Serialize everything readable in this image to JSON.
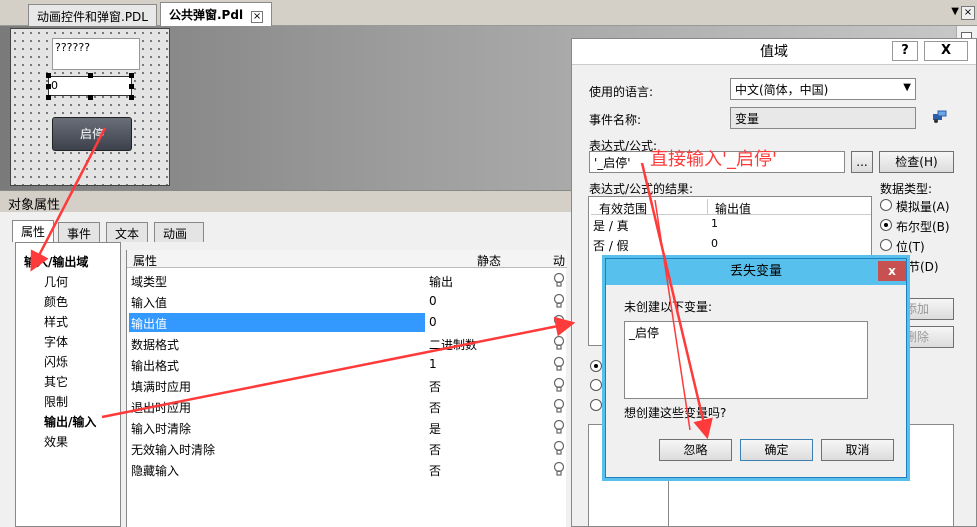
{
  "tabs": [
    {
      "label": "动画控件和弹窗.PDL",
      "active": false
    },
    {
      "label": "公共弹窗.Pdl",
      "active": true
    }
  ],
  "canvas": {
    "io_field_1": "??????",
    "io_field_2": "0",
    "start_button": "启停"
  },
  "props_panel": {
    "title": "对象属性",
    "tabs": [
      "属性",
      "事件",
      "文本",
      "动画"
    ],
    "tree": [
      "输入/输出域",
      "几何",
      "颜色",
      "样式",
      "字体",
      "闪烁",
      "其它",
      "限制",
      "输出/输入",
      "效果"
    ],
    "grid_headers": [
      "属性",
      "静态",
      "动"
    ],
    "rows": [
      {
        "name": "域类型",
        "value": "输出"
      },
      {
        "name": "输入值",
        "value": "0"
      },
      {
        "name": "输出值",
        "value": "0",
        "selected": true
      },
      {
        "name": "数据格式",
        "value": "二进制数"
      },
      {
        "name": "输出格式",
        "value": "1"
      },
      {
        "name": "填满时应用",
        "value": "否"
      },
      {
        "name": "退出时应用",
        "value": "否"
      },
      {
        "name": "输入时清除",
        "value": "是"
      },
      {
        "name": "无效输入时清除",
        "value": "否"
      },
      {
        "name": "隐藏输入",
        "value": "否"
      }
    ]
  },
  "value_dialog": {
    "title": "值域",
    "help_button": "?",
    "close_button": "X",
    "language_label": "使用的语言:",
    "language_value": "中文(简体，中国)",
    "event_label": "事件名称:",
    "event_value": "变量",
    "expr_label": "表达式/公式:",
    "expr_value": "'_启停'",
    "browse_button": "...",
    "check_button": "检查(H)",
    "result_label": "表达式/公式的结果:",
    "result_headers": [
      "有效范围",
      "输出值"
    ],
    "result_rows": [
      {
        "range": "是 / 真",
        "value": "1"
      },
      {
        "range": "否 / 假",
        "value": "0"
      }
    ],
    "data_type_label": "数据类型:",
    "data_types": [
      {
        "label": "模拟量(A)",
        "checked": false
      },
      {
        "label": "布尔型(B)",
        "checked": true
      },
      {
        "label": "位(T)",
        "checked": false
      },
      {
        "label": "字节(D)",
        "checked": false
      }
    ],
    "add_button": "添加",
    "delete_button": "删除"
  },
  "lost_var_dialog": {
    "title": "丢失变量",
    "close": "x",
    "message": "未创建以下变量:",
    "variable": "_启停",
    "question": "想创建这些变量吗?",
    "buttons": [
      "忽略",
      "确定",
      "取消"
    ]
  },
  "annotation": "直接输入'_启停'",
  "colors": {
    "arrow": "#ff3a3a",
    "selection": "#3399ff",
    "dialog_title": "#58c0ec",
    "close_red": "#c75050"
  }
}
